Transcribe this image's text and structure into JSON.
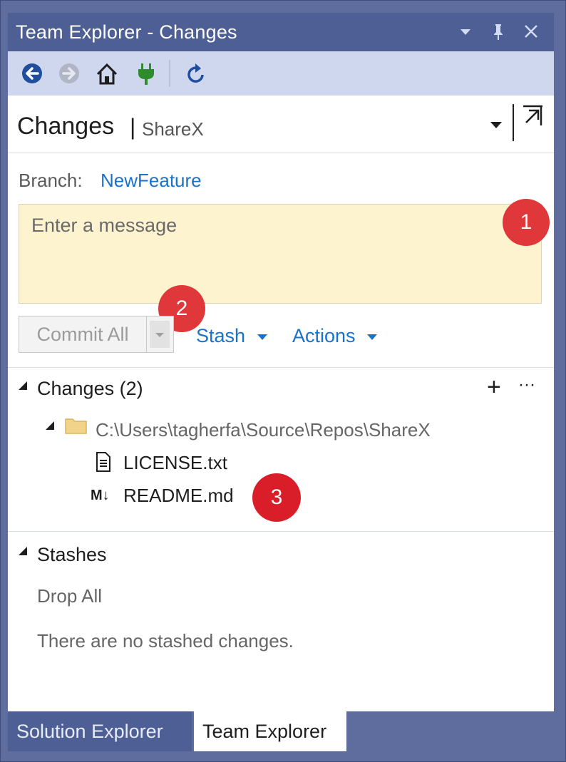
{
  "window": {
    "title": "Team Explorer - Changes",
    "controls": [
      "dropdown-arrow",
      "pin",
      "close"
    ]
  },
  "toolbar": {
    "buttons": [
      "back",
      "forward",
      "home",
      "connect",
      "refresh"
    ]
  },
  "header": {
    "title": "Changes",
    "separator": "|",
    "repo": "ShareX"
  },
  "branch": {
    "label": "Branch:",
    "name": "NewFeature"
  },
  "message": {
    "placeholder": "Enter a message"
  },
  "actions": {
    "commit_all": "Commit All",
    "stash": "Stash",
    "actions": "Actions"
  },
  "changes": {
    "title": "Changes (2)",
    "folder": "C:\\Users\\tagherfa\\Source\\Repos\\ShareX",
    "files": [
      {
        "name": "LICENSE.txt",
        "icon": "document-icon"
      },
      {
        "name": "README.md",
        "icon": "markdown-icon",
        "icon_label": "M↓"
      }
    ],
    "add_symbol": "+",
    "more_symbol": "···"
  },
  "stashes": {
    "title": "Stashes",
    "drop_all": "Drop All",
    "empty_text": "There are no stashed changes."
  },
  "callouts": [
    "1",
    "2",
    "3"
  ],
  "tabs": {
    "solution_explorer": "Solution Explorer",
    "team_explorer": "Team Explorer"
  },
  "colors": {
    "titlebar": "#4e5f96",
    "toolbar": "#cfd7ee",
    "link": "#1a73c8",
    "message_bg": "#fdf4cf",
    "callout": "#e0383a"
  }
}
